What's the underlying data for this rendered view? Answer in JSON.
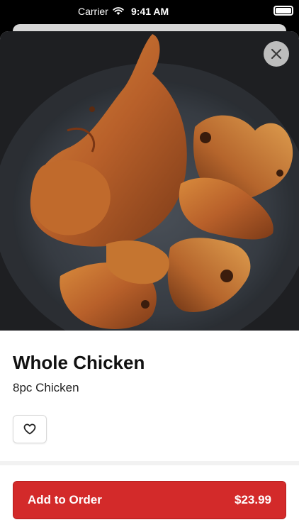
{
  "status_bar": {
    "carrier": "Carrier",
    "time": "9:41 AM",
    "icons": [
      "wifi-icon",
      "battery-icon"
    ]
  },
  "item": {
    "name": "Whole Chicken",
    "description": "8pc Chicken",
    "image_subject": "roasted-chicken-on-plate"
  },
  "actions": {
    "close_icon": "close-icon",
    "favorite_icon": "heart-icon",
    "add_label": "Add to Order",
    "price": "$23.99"
  },
  "colors": {
    "accent": "#d32a2a",
    "close_bg": "#bdbdbd"
  }
}
